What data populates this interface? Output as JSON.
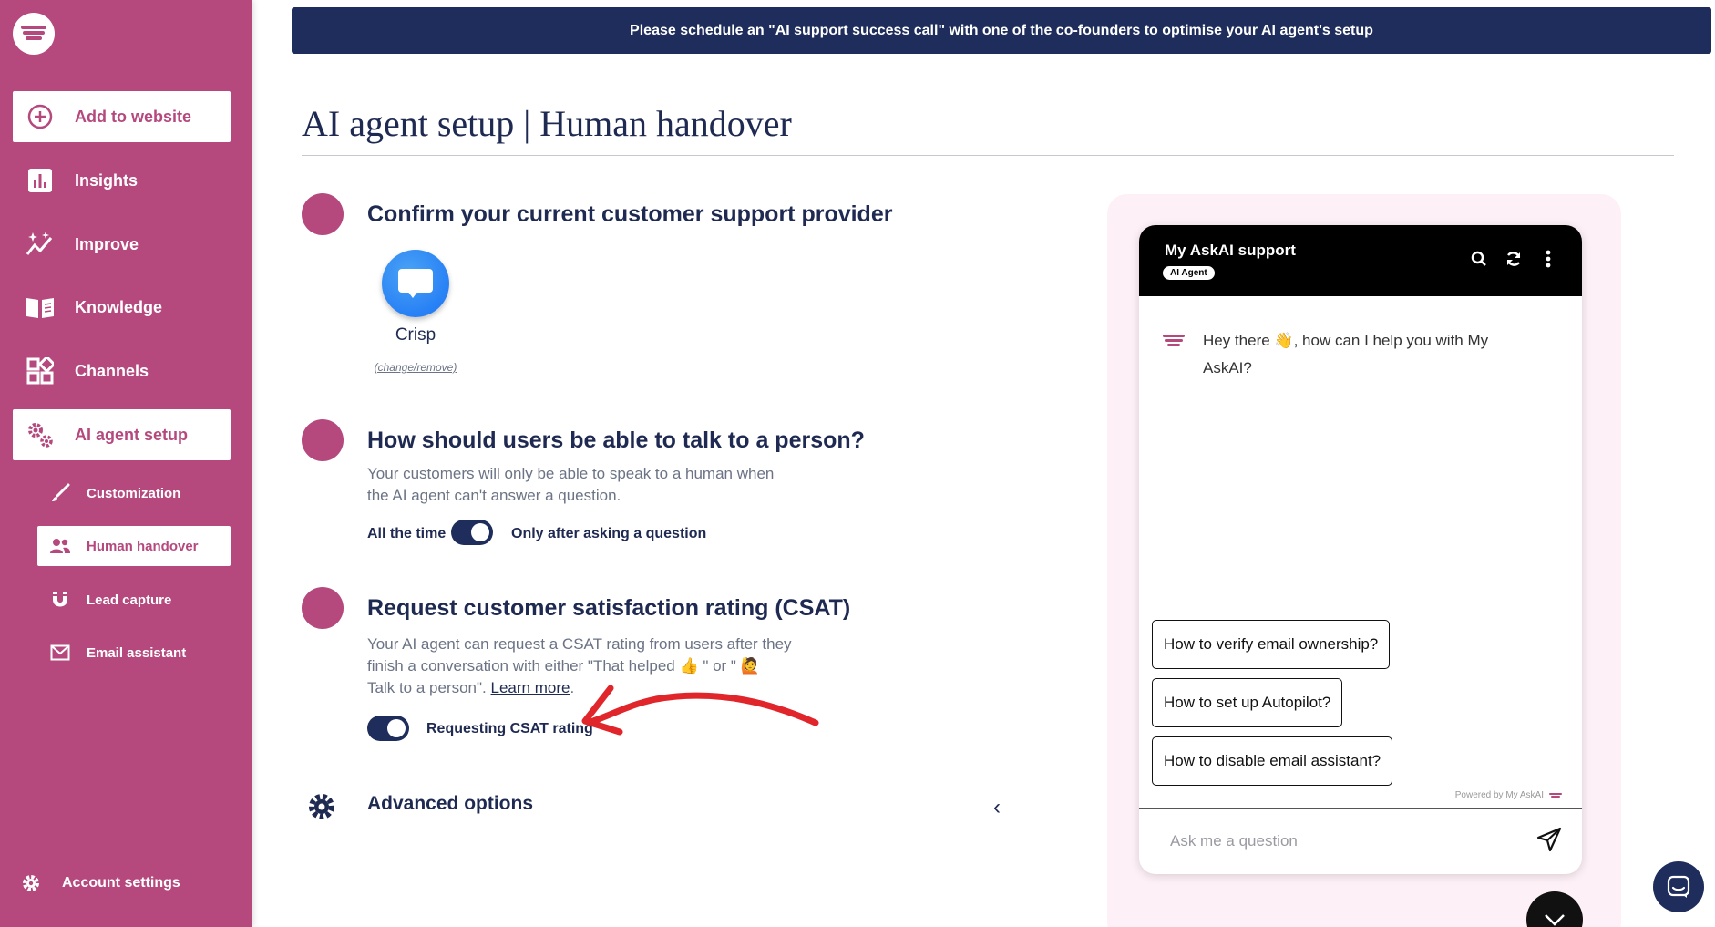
{
  "sidebar": {
    "nav": [
      {
        "label": "Add to website",
        "icon": "plus-circle-icon"
      },
      {
        "label": "Insights",
        "icon": "bar-chart-icon"
      },
      {
        "label": "Improve",
        "icon": "sparkle-chart-icon"
      },
      {
        "label": "Knowledge",
        "icon": "book-icon"
      },
      {
        "label": "Channels",
        "icon": "grid-icon"
      },
      {
        "label": "AI agent setup",
        "icon": "gears-icon"
      }
    ],
    "sub": [
      {
        "label": "Customization",
        "icon": "brush-icon"
      },
      {
        "label": "Human handover",
        "icon": "people-icon"
      },
      {
        "label": "Lead capture",
        "icon": "magnet-icon"
      },
      {
        "label": "Email assistant",
        "icon": "envelope-icon"
      }
    ],
    "account": "Account settings"
  },
  "banner": "Please schedule an \"AI support success call\" with one of the co-founders to optimise your AI agent's setup",
  "page_title": "AI agent setup | Human handover",
  "section1": {
    "title": "Confirm your current customer support provider",
    "provider": "Crisp",
    "change": "(change/remove)"
  },
  "section2": {
    "title": "How should users be able to talk to a person?",
    "desc_line1": "Your customers will only be able to speak to a human when",
    "desc_line2": "the AI agent can't answer a question.",
    "left_label": "All the time",
    "right_label": "Only after asking a question",
    "toggle_on": true
  },
  "section3": {
    "title": "Request customer satisfaction rating (CSAT)",
    "desc_line1": "Your AI agent can request a CSAT rating from users after they",
    "desc_line2": "finish a conversation with either \"That helped 👍 \" or \" 🙋",
    "desc_line3": "Talk to a person\".",
    "learn_more": "Learn more",
    "learn_suffix": ".",
    "toggle_label": "Requesting CSAT rating",
    "toggle_on": true
  },
  "advanced": {
    "label": "Advanced options",
    "chevron": "‹"
  },
  "chat": {
    "title": "My AskAI support",
    "badge": "AI Agent",
    "greeting": "Hey there 👋, how can I help you with My AskAI?",
    "suggestions": [
      "How to verify email ownership?",
      "How to set up Autopilot?",
      "How to disable email assistant?"
    ],
    "powered_by": "Powered by My AskAI",
    "input_placeholder": "Ask me a question"
  },
  "colors": {
    "sidebar": "#b5497e",
    "navy": "#1e2d5b",
    "annotation_arrow": "#e0262a"
  }
}
